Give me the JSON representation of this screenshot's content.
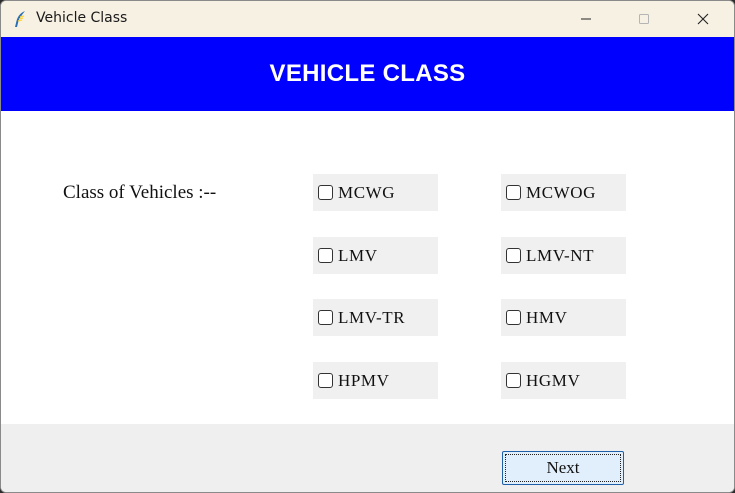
{
  "window": {
    "title": "Vehicle Class",
    "icon": "python-feather-icon",
    "controls": [
      "minimize-icon",
      "maximize-icon",
      "close-icon"
    ]
  },
  "header": {
    "title": "VEHICLE CLASS",
    "background": "#0000ff",
    "color": "#ffffff"
  },
  "form": {
    "label": "Class of Vehicles :--",
    "options": [
      {
        "label": "MCWG",
        "checked": false
      },
      {
        "label": "MCWOG",
        "checked": false
      },
      {
        "label": "LMV",
        "checked": false
      },
      {
        "label": "LMV-NT",
        "checked": false
      },
      {
        "label": "LMV-TR",
        "checked": false
      },
      {
        "label": "HMV",
        "checked": false
      },
      {
        "label": "HPMV",
        "checked": false
      },
      {
        "label": "HGMV",
        "checked": false
      }
    ]
  },
  "footer": {
    "next_label": "Next"
  }
}
